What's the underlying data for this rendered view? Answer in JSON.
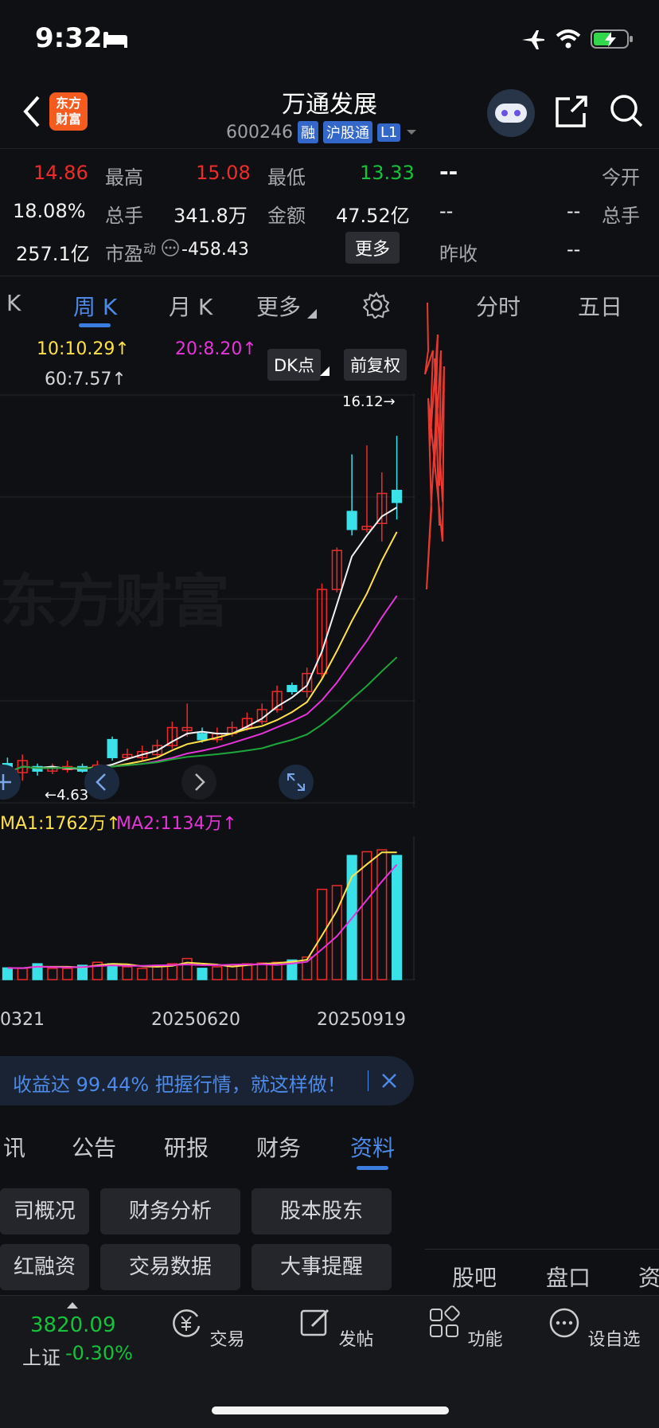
{
  "status": {
    "time": "9:32"
  },
  "header": {
    "title": "万通发展",
    "code": "600246",
    "tags": [
      "融",
      "沪股通",
      "L1"
    ],
    "logo_text": "东方\n财富"
  },
  "quote": {
    "price_partial": "14.86",
    "high_label": "最高",
    "high": "15.08",
    "low_label": "最低",
    "low": "13.33",
    "change_pct": "18.08%",
    "vol_label": "总手",
    "vol": "341.8万",
    "amount_label": "金额",
    "amount": "47.52亿",
    "mktcap": "257.1亿",
    "pe_label": "市盈",
    "pe_sup": "动",
    "pe": "-458.43",
    "more": "更多",
    "right_dash": "--",
    "open_label": "今开",
    "r_total_label": "总手",
    "prev_close_label": "昨收",
    "r_val1": "--",
    "r_val2": "--",
    "r_val3": "--"
  },
  "ktabs": {
    "k": "K",
    "week": "周 K",
    "month": "月 K",
    "more": "更多"
  },
  "righttabs": {
    "fenshi": "分时",
    "wuri": "五日"
  },
  "indicators": {
    "ma10": "10:10.29↑",
    "ma20": "20:8.20↑",
    "ma60": "60:7.57↑",
    "dk": "DK点",
    "fuquan": "前复权",
    "hi_mark": "16.12→",
    "lo_mark": "←4.63",
    "vma1": "MA1:1762万↑",
    "vma2": "MA2:1134万↑",
    "watermark": "东方财富"
  },
  "dates": [
    "0321",
    "20250620",
    "20250919"
  ],
  "banner": {
    "text": "收益达 99.44% 把握行情，就这样做！"
  },
  "infotabs": [
    "讯",
    "公告",
    "研报",
    "财务",
    "资料"
  ],
  "infobuttons": [
    "司概况",
    "财务分析",
    "股本股东",
    "红融资",
    "交易数据",
    "大事提醒"
  ],
  "rbtabs": [
    "股吧",
    "盘口",
    "资"
  ],
  "nav": {
    "index_value": "3820.09",
    "index_name": "上证",
    "index_change": "-0.30%",
    "trade": "交易",
    "post": "发帖",
    "func": "功能",
    "watch": "设自选"
  },
  "colors": {
    "up": "#ee2b2b",
    "down": "#3be1e8",
    "ma10": "#f2f2f2",
    "ma20": "#ffe14a",
    "ma60": "#e535d8",
    "ma120": "#1fa63a",
    "accent": "#3c7ee0"
  },
  "chart_data": {
    "type": "candlestick",
    "x": [
      "0321",
      "",
      "",
      "",
      "",
      "",
      "",
      "",
      "",
      "",
      "",
      "",
      "",
      "20250620",
      "",
      "",
      "",
      "",
      "",
      "",
      "",
      "",
      "",
      "",
      "",
      "",
      "20250919"
    ],
    "candles": [
      {
        "o": 5.2,
        "c": 4.9,
        "h": 5.4,
        "l": 4.7
      },
      {
        "o": 4.9,
        "c": 5.3,
        "h": 5.5,
        "l": 4.63
      },
      {
        "o": 5.1,
        "c": 4.95,
        "h": 5.2,
        "l": 4.8
      },
      {
        "o": 4.95,
        "c": 5.05,
        "h": 5.2,
        "l": 4.85
      },
      {
        "o": 5.0,
        "c": 5.1,
        "h": 5.3,
        "l": 4.9
      },
      {
        "o": 5.1,
        "c": 4.95,
        "h": 5.2,
        "l": 4.9
      },
      {
        "o": 5.0,
        "c": 5.15,
        "h": 5.3,
        "l": 4.9
      },
      {
        "o": 6.0,
        "c": 5.4,
        "h": 6.1,
        "l": 5.3
      },
      {
        "o": 5.4,
        "c": 5.5,
        "h": 5.7,
        "l": 5.3
      },
      {
        "o": 5.4,
        "c": 5.6,
        "h": 5.8,
        "l": 5.3
      },
      {
        "o": 5.5,
        "c": 5.8,
        "h": 6.0,
        "l": 5.4
      },
      {
        "o": 5.8,
        "c": 6.4,
        "h": 6.6,
        "l": 5.7
      },
      {
        "o": 6.3,
        "c": 6.4,
        "h": 7.2,
        "l": 6.1
      },
      {
        "o": 6.2,
        "c": 6.0,
        "h": 6.4,
        "l": 5.9
      },
      {
        "o": 6.0,
        "c": 6.2,
        "h": 6.4,
        "l": 5.9
      },
      {
        "o": 6.2,
        "c": 6.4,
        "h": 6.6,
        "l": 6.1
      },
      {
        "o": 6.4,
        "c": 6.7,
        "h": 6.9,
        "l": 6.3
      },
      {
        "o": 6.6,
        "c": 7.0,
        "h": 7.2,
        "l": 6.5
      },
      {
        "o": 7.0,
        "c": 7.6,
        "h": 7.8,
        "l": 6.9
      },
      {
        "o": 7.8,
        "c": 7.6,
        "h": 7.9,
        "l": 7.5
      },
      {
        "o": 7.6,
        "c": 8.2,
        "h": 8.4,
        "l": 7.4
      },
      {
        "o": 8.2,
        "c": 11.0,
        "h": 11.2,
        "l": 8.0
      },
      {
        "o": 11.0,
        "c": 12.3,
        "h": 12.4,
        "l": 10.9
      },
      {
        "o": 13.6,
        "c": 13.0,
        "h": 15.5,
        "l": 12.8
      },
      {
        "o": 13.0,
        "c": 13.1,
        "h": 15.8,
        "l": 12.9
      },
      {
        "o": 13.2,
        "c": 14.2,
        "h": 14.9,
        "l": 12.6
      },
      {
        "o": 14.3,
        "c": 13.9,
        "h": 16.12,
        "l": 13.33
      }
    ],
    "ylim": [
      4.0,
      17.0
    ],
    "volume": [
      310,
      300,
      420,
      300,
      300,
      380,
      460,
      420,
      340,
      300,
      380,
      420,
      560,
      300,
      340,
      390,
      420,
      440,
      460,
      520,
      600,
      2400,
      2500,
      3300,
      3400,
      3450,
      3300
    ]
  }
}
